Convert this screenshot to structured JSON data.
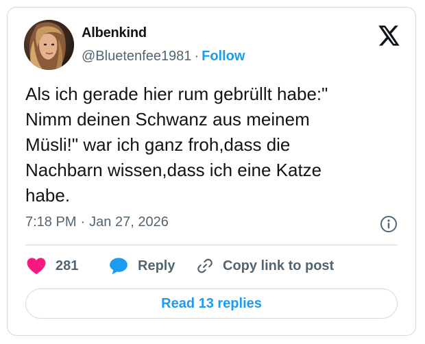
{
  "author": {
    "display_name": "Albenkind",
    "handle": "@Bluetenfee1981",
    "separator": "·",
    "follow_label": "Follow"
  },
  "tweet": {
    "text": "Als ich gerade hier rum gebrüllt habe:\"\nNimm deinen Schwanz aus meinem\nMüsli!\" war ich ganz froh,dass die\nNachbarn wissen,dass ich eine Katze\nhabe.",
    "time": "7:18 PM",
    "separator": "·",
    "date": "Jan 27, 2026"
  },
  "actions": {
    "like_count": "281",
    "reply_label": "Reply",
    "copy_link_label": "Copy link to post"
  },
  "read_replies_label": "Read 13 replies",
  "icons": {
    "brand": "x-logo-icon",
    "info": "info-icon",
    "like": "heart-icon",
    "reply": "reply-bubble-icon",
    "copy": "link-icon"
  },
  "colors": {
    "accent": "#1d9bf0",
    "heart": "#f91880",
    "text": "#0f1419",
    "secondary": "#536471",
    "border": "#cfd9de"
  }
}
